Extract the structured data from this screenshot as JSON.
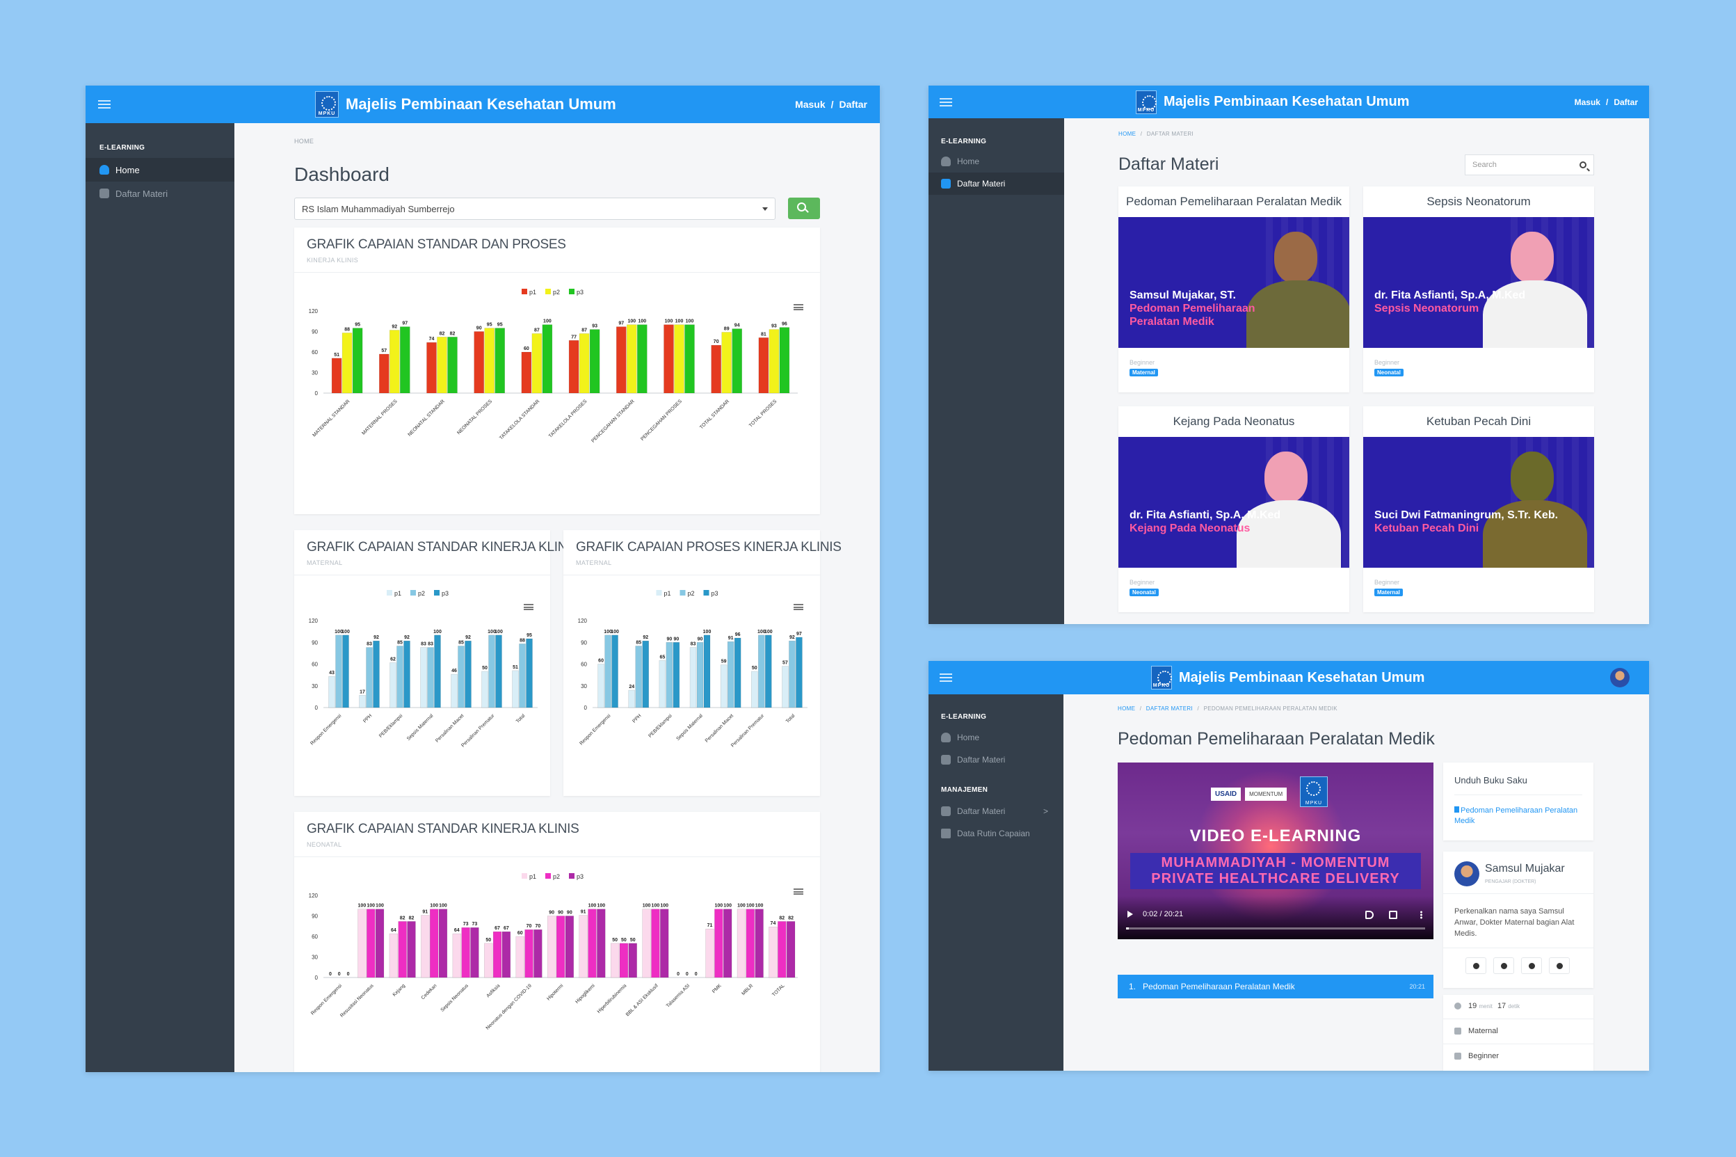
{
  "app": {
    "brand": "Majelis Pembinaan Kesehatan Umum",
    "login": "Masuk",
    "sep": "/",
    "register": "Daftar"
  },
  "colors": {
    "topbar": "#2196f3",
    "sidebar": "#343f4b",
    "page_bg": "#94c9f5",
    "p1_red": "#e53a1f",
    "p2_yellow": "#f2f21a",
    "p3_green": "#21c521",
    "thumb_bg": "#2a1fa8",
    "accent_pink": "#ff5aa0"
  },
  "dashboard": {
    "sidebar": {
      "head": "E-LEARNING",
      "items": [
        {
          "label": "Home",
          "icon": "user-icon",
          "active": true
        },
        {
          "label": "Daftar Materi",
          "icon": "book-icon",
          "active": false
        }
      ]
    },
    "breadcrumb": "HOME",
    "title": "Dashboard",
    "select_value": "RS Islam Muhammadiyah Sumberrejo",
    "cards": [
      {
        "title": "GRAFIK CAPAIAN STANDAR DAN PROSES",
        "subtitle": "KINERJA KLINIS"
      },
      {
        "title": "GRAFIK CAPAIAN STANDAR KINERJA KLINIS",
        "subtitle": "MATERNAL"
      },
      {
        "title": "GRAFIK CAPAIAN PROSES KINERJA KLINIS",
        "subtitle": "MATERNAL"
      },
      {
        "title": "GRAFIK CAPAIAN STANDAR KINERJA KLINIS",
        "subtitle": "NEONATAL"
      }
    ]
  },
  "chart_data": [
    {
      "type": "bar",
      "title": "GRAFIK CAPAIAN STANDAR DAN PROSES",
      "subtitle": "KINERJA KLINIS",
      "categories": [
        "MATERNAL STANDAR",
        "MATERNAL PROSES",
        "NEONATAL STANDAR",
        "NEONATAL PROSES",
        "TATAKELOLA STANDAR",
        "TATAKELOLA PROSES",
        "PENCEGAHAN STANDAR",
        "PENCEGAHAN PROSES",
        "TOTAL STANDAR",
        "TOTAL PROSES"
      ],
      "series": [
        {
          "name": "p1",
          "color": "#e53a1f",
          "values": [
            51,
            57,
            74,
            90,
            60,
            77,
            97,
            100,
            70,
            81
          ]
        },
        {
          "name": "p2",
          "color": "#f2f21a",
          "values": [
            88,
            92,
            82,
            95,
            87,
            87,
            100,
            100,
            89,
            93
          ]
        },
        {
          "name": "p3",
          "color": "#21c521",
          "values": [
            95,
            97,
            82,
            95,
            100,
            93,
            100,
            100,
            94,
            96
          ]
        }
      ],
      "ylim": [
        0,
        120
      ],
      "yticks": [
        0,
        30,
        60,
        90,
        120
      ],
      "legend": "top-center",
      "grid": false
    },
    {
      "type": "bar",
      "title": "GRAFIK CAPAIAN STANDAR KINERJA KLINIS",
      "subtitle": "MATERNAL",
      "categories": [
        "Respon Emergensi",
        "PPH",
        "PEB/Eklampsi",
        "Sepsis Maternal",
        "Persalinan Macet",
        "Persalinan Prematur",
        "Total"
      ],
      "series": [
        {
          "name": "p1",
          "color": "#d9eef7",
          "values": [
            43,
            17,
            62,
            83,
            46,
            50,
            51
          ]
        },
        {
          "name": "p2",
          "color": "#87c8e3",
          "values": [
            100,
            83,
            85,
            83,
            85,
            100,
            88
          ]
        },
        {
          "name": "p3",
          "color": "#2a98c8",
          "values": [
            100,
            92,
            92,
            100,
            92,
            100,
            95
          ]
        }
      ],
      "ylim": [
        0,
        120
      ],
      "yticks": [
        0,
        30,
        60,
        90,
        120
      ],
      "legend": "top-center",
      "grid": false
    },
    {
      "type": "bar",
      "title": "GRAFIK CAPAIAN PROSES KINERJA KLINIS",
      "subtitle": "MATERNAL",
      "categories": [
        "Respon Emergensi",
        "PPH",
        "PEB/Eklampsi",
        "Sepsis Maternal",
        "Persalinan Macet",
        "Persalinan Prematur",
        "Total"
      ],
      "series": [
        {
          "name": "p1",
          "color": "#d9eef7",
          "values": [
            60,
            24,
            65,
            83,
            59,
            50,
            57
          ]
        },
        {
          "name": "p2",
          "color": "#87c8e3",
          "values": [
            100,
            85,
            90,
            90,
            91,
            100,
            92
          ]
        },
        {
          "name": "p3",
          "color": "#2a98c8",
          "values": [
            100,
            92,
            90,
            100,
            96,
            100,
            97
          ]
        }
      ],
      "ylim": [
        0,
        120
      ],
      "yticks": [
        0,
        30,
        60,
        90,
        120
      ],
      "legend": "top-center",
      "grid": false
    },
    {
      "type": "bar",
      "title": "GRAFIK CAPAIAN STANDAR KINERJA KLINIS",
      "subtitle": "NEONATAL",
      "categories": [
        "Respon Emergensi",
        "Resusitasi Neonatus",
        "Kejang",
        "Cedekan",
        "Sepsis Neonatus",
        "Asfiksia",
        "Neonatus dengan COVID-19",
        "Hipotermi",
        "Hipoglikemi",
        "Hiperbilirubinemia",
        "BBL & ASI Eksklusif",
        "Talasemia ASI",
        "PMK",
        "MBLR",
        "TOTAL"
      ],
      "series": [
        {
          "name": "p1",
          "color": "#fbd9ec",
          "values": [
            0,
            100,
            64,
            91,
            64,
            50,
            60,
            90,
            91,
            50,
            100,
            0,
            71,
            100,
            74
          ]
        },
        {
          "name": "p2",
          "color": "#ee2ec3",
          "values": [
            0,
            100,
            82,
            100,
            73,
            67,
            70,
            90,
            100,
            50,
            100,
            0,
            100,
            100,
            82
          ]
        },
        {
          "name": "p3",
          "color": "#ad2aa7",
          "values": [
            0,
            100,
            82,
            100,
            73,
            67,
            70,
            90,
            100,
            50,
            100,
            0,
            100,
            100,
            82
          ]
        }
      ],
      "ylim": [
        0,
        120
      ],
      "yticks": [
        0,
        30,
        60,
        90,
        120
      ],
      "legend": "top-center",
      "grid": false
    }
  ],
  "daftar": {
    "sidebar": {
      "head": "E-LEARNING",
      "items": [
        {
          "label": "Home",
          "icon": "user-icon",
          "active": false
        },
        {
          "label": "Daftar Materi",
          "icon": "book-icon",
          "active": true
        }
      ]
    },
    "breadcrumb": {
      "home": "HOME",
      "sep": "/",
      "current": "DAFTAR MATERI"
    },
    "title": "Daftar Materi",
    "search_placeholder": "Search",
    "materials": [
      {
        "title": "Pedoman Pemeliharaan Peralatan Medik",
        "speaker": "Samsul Mujakar, ST.",
        "topic_1": "Pedoman Pemeliharaan",
        "topic_2": "Peralatan Medik",
        "level": "Beginner",
        "tag": "Maternal"
      },
      {
        "title": "Sepsis Neonatorum",
        "speaker": "dr. Fita Asfianti, Sp.A, M.Ked",
        "topic_1": "Sepsis Neonatorum",
        "topic_2": "",
        "level": "Beginner",
        "tag": "Neonatal"
      },
      {
        "title": "Kejang Pada Neonatus",
        "speaker": "dr. Fita Asfianti, Sp.A, M.Ked",
        "topic_1": "Kejang Pada Neonatus",
        "topic_2": "",
        "level": "Beginner",
        "tag": "Neonatal"
      },
      {
        "title": "Ketuban Pecah Dini",
        "speaker": "Suci Dwi Fatmaningrum, S.Tr. Keb.",
        "topic_1": "Ketuban Pecah Dini",
        "topic_2": "",
        "level": "Beginner",
        "tag": "Maternal"
      }
    ]
  },
  "detail": {
    "sidebar": {
      "head": "E-LEARNING",
      "items": [
        {
          "label": "Home"
        },
        {
          "label": "Daftar Materi"
        }
      ],
      "head2": "MANAJEMEN",
      "items2": [
        {
          "label": "Daftar Materi",
          "chevron": ">"
        },
        {
          "label": "Data Rutin Capaian"
        }
      ]
    },
    "breadcrumb": {
      "home": "HOME",
      "sep": "/",
      "list": "DAFTAR MATERI",
      "current": "PEDOMAN PEMELIHARAAN PERALATAN MEDIK"
    },
    "title": "Pedoman Pemeliharaan Peralatan Medik",
    "video": {
      "sponsor_1": "USAID",
      "sponsor_2": "MOMENTUM",
      "headline": "VIDEO E-LEARNING",
      "line_1": "MUHAMMADIYAH - MOMENTUM",
      "line_2": "PRIVATE HEALTHCARE DELIVERY",
      "time": "0:02 / 20:21",
      "progress": 0.002
    },
    "playlist": [
      {
        "number": "1.",
        "label": "Pedoman Pemeliharaan Peralatan Medik",
        "duration": "20:21"
      }
    ],
    "download": {
      "title": "Unduh Buku Saku",
      "link": "Pedoman Pemeliharaan Peralatan Medik"
    },
    "author": {
      "name": "Samsul Mujakar",
      "role": "PENGAJAR (DOKTER)",
      "bio": "Perkenalkan nama saya Samsul Anwar, Dokter Maternal bagian Alat Medis.",
      "socials": [
        "facebook-icon",
        "twitter-icon",
        "instagram-icon",
        "github-icon"
      ]
    },
    "meta": {
      "minutes": "19",
      "minutes_unit": "menit",
      "seconds": "17",
      "seconds_unit": "detik",
      "category": "Maternal",
      "level": "Beginner"
    }
  }
}
